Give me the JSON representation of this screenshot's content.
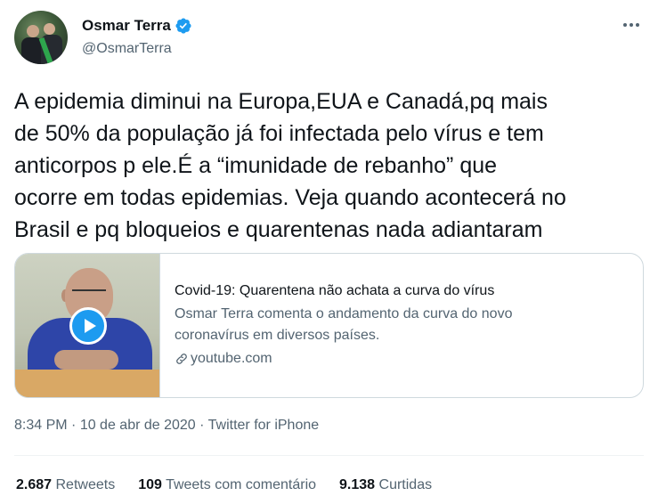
{
  "author": {
    "display_name": "Osmar Terra",
    "handle": "@OsmarTerra",
    "verified": true
  },
  "tweet": {
    "text": "A epidemia diminui na Europa,EUA e Canadá,pq mais\nde 50% da população já foi infectada pelo vírus e tem\nanticorpos p ele.É a “imunidade de rebanho” que\nocorre em todas epidemias. Veja quando acontecerá no\nBrasil e pq bloqueios e quarentenas nada adiantaram"
  },
  "card": {
    "title": "Covid-19: Quarentena não achata a curva do vírus",
    "description": "Osmar Terra comenta o andamento da curva do novo coronavírus em diversos países.",
    "domain": "youtube.com"
  },
  "meta": {
    "time": "8:34 PM",
    "separator": " · ",
    "date": "10 de abr de 2020",
    "source": "Twitter for iPhone"
  },
  "stats": {
    "retweets_count": "2.687",
    "retweets_label": "Retweets",
    "quotes_count": "109",
    "quotes_label": "Tweets com comentário",
    "likes_count": "9.138",
    "likes_label": "Curtidas"
  },
  "colors": {
    "accent": "#1d9bf0",
    "text": "#0f1419",
    "secondary": "#536471"
  }
}
